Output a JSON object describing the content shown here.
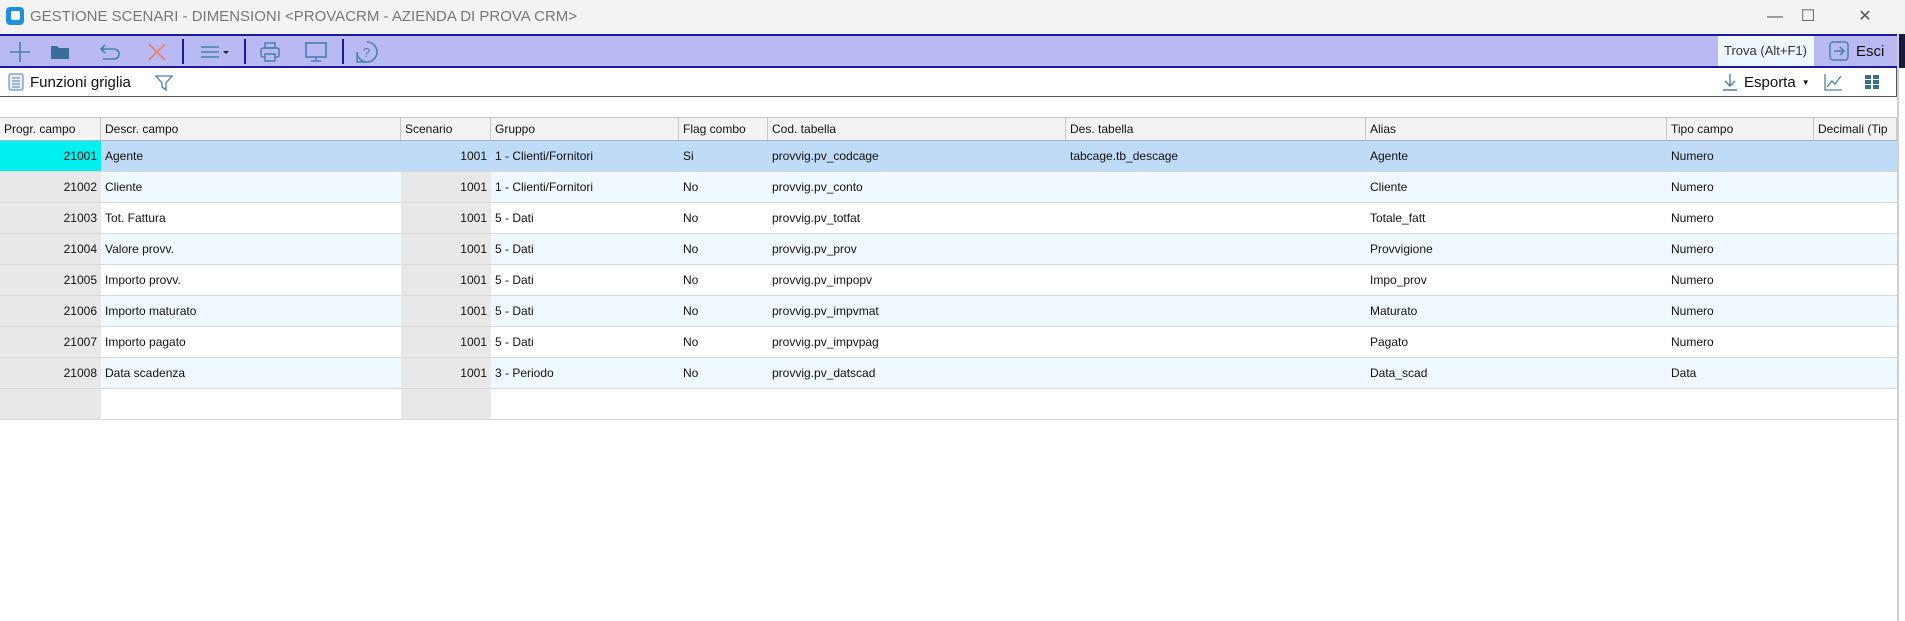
{
  "window": {
    "title": "GESTIONE SCENARI - DIMENSIONI <PROVACRM - AZIENDA DI PROVA CRM>",
    "minimize": "—",
    "maximize": "☐",
    "close": "✕"
  },
  "toolbar": {
    "find_placeholder": "Trova (Alt+F1)",
    "exit_label": "Esci"
  },
  "toolbar2": {
    "grid_functions": "Funzioni griglia",
    "export": "Esporta"
  },
  "colors": {
    "toolbar_bg": "#b9b9f3",
    "selected_row": "#bfdbf7",
    "selected_cell": "#00f0f0"
  },
  "grid": {
    "columns": [
      "Progr. campo",
      "Descr. campo",
      "Scenario",
      "Gruppo",
      "Flag combo",
      "Cod. tabella",
      "Des. tabella",
      "Alias",
      "Tipo campo",
      "Decimali (Tip"
    ],
    "rows": [
      [
        "21001",
        "Agente",
        "1001",
        "1 - Clienti/Fornitori",
        "Si",
        "provvig.pv_codcage",
        "tabcage.tb_descage",
        "Agente",
        "Numero",
        ""
      ],
      [
        "21002",
        "Cliente",
        "1001",
        "1 - Clienti/Fornitori",
        "No",
        "provvig.pv_conto",
        "",
        "Cliente",
        "Numero",
        ""
      ],
      [
        "21003",
        "Tot. Fattura",
        "1001",
        "5 - Dati",
        "No",
        "provvig.pv_totfat",
        "",
        "Totale_fatt",
        "Numero",
        ""
      ],
      [
        "21004",
        "Valore provv.",
        "1001",
        "5 - Dati",
        "No",
        "provvig.pv_prov",
        "",
        "Provvigione",
        "Numero",
        ""
      ],
      [
        "21005",
        "Importo provv.",
        "1001",
        "5 - Dati",
        "No",
        "provvig.pv_impopv",
        "",
        "Impo_prov",
        "Numero",
        ""
      ],
      [
        "21006",
        "Importo maturato",
        "1001",
        "5 - Dati",
        "No",
        "provvig.pv_impvmat",
        "",
        "Maturato",
        "Numero",
        ""
      ],
      [
        "21007",
        "Importo pagato",
        "1001",
        "5 - Dati",
        "No",
        "provvig.pv_impvpag",
        "",
        "Pagato",
        "Numero",
        ""
      ],
      [
        "21008",
        "Data scadenza",
        "1001",
        "3 - Periodo",
        "No",
        "provvig.pv_datscad",
        "",
        "Data_scad",
        "Data",
        ""
      ]
    ]
  }
}
